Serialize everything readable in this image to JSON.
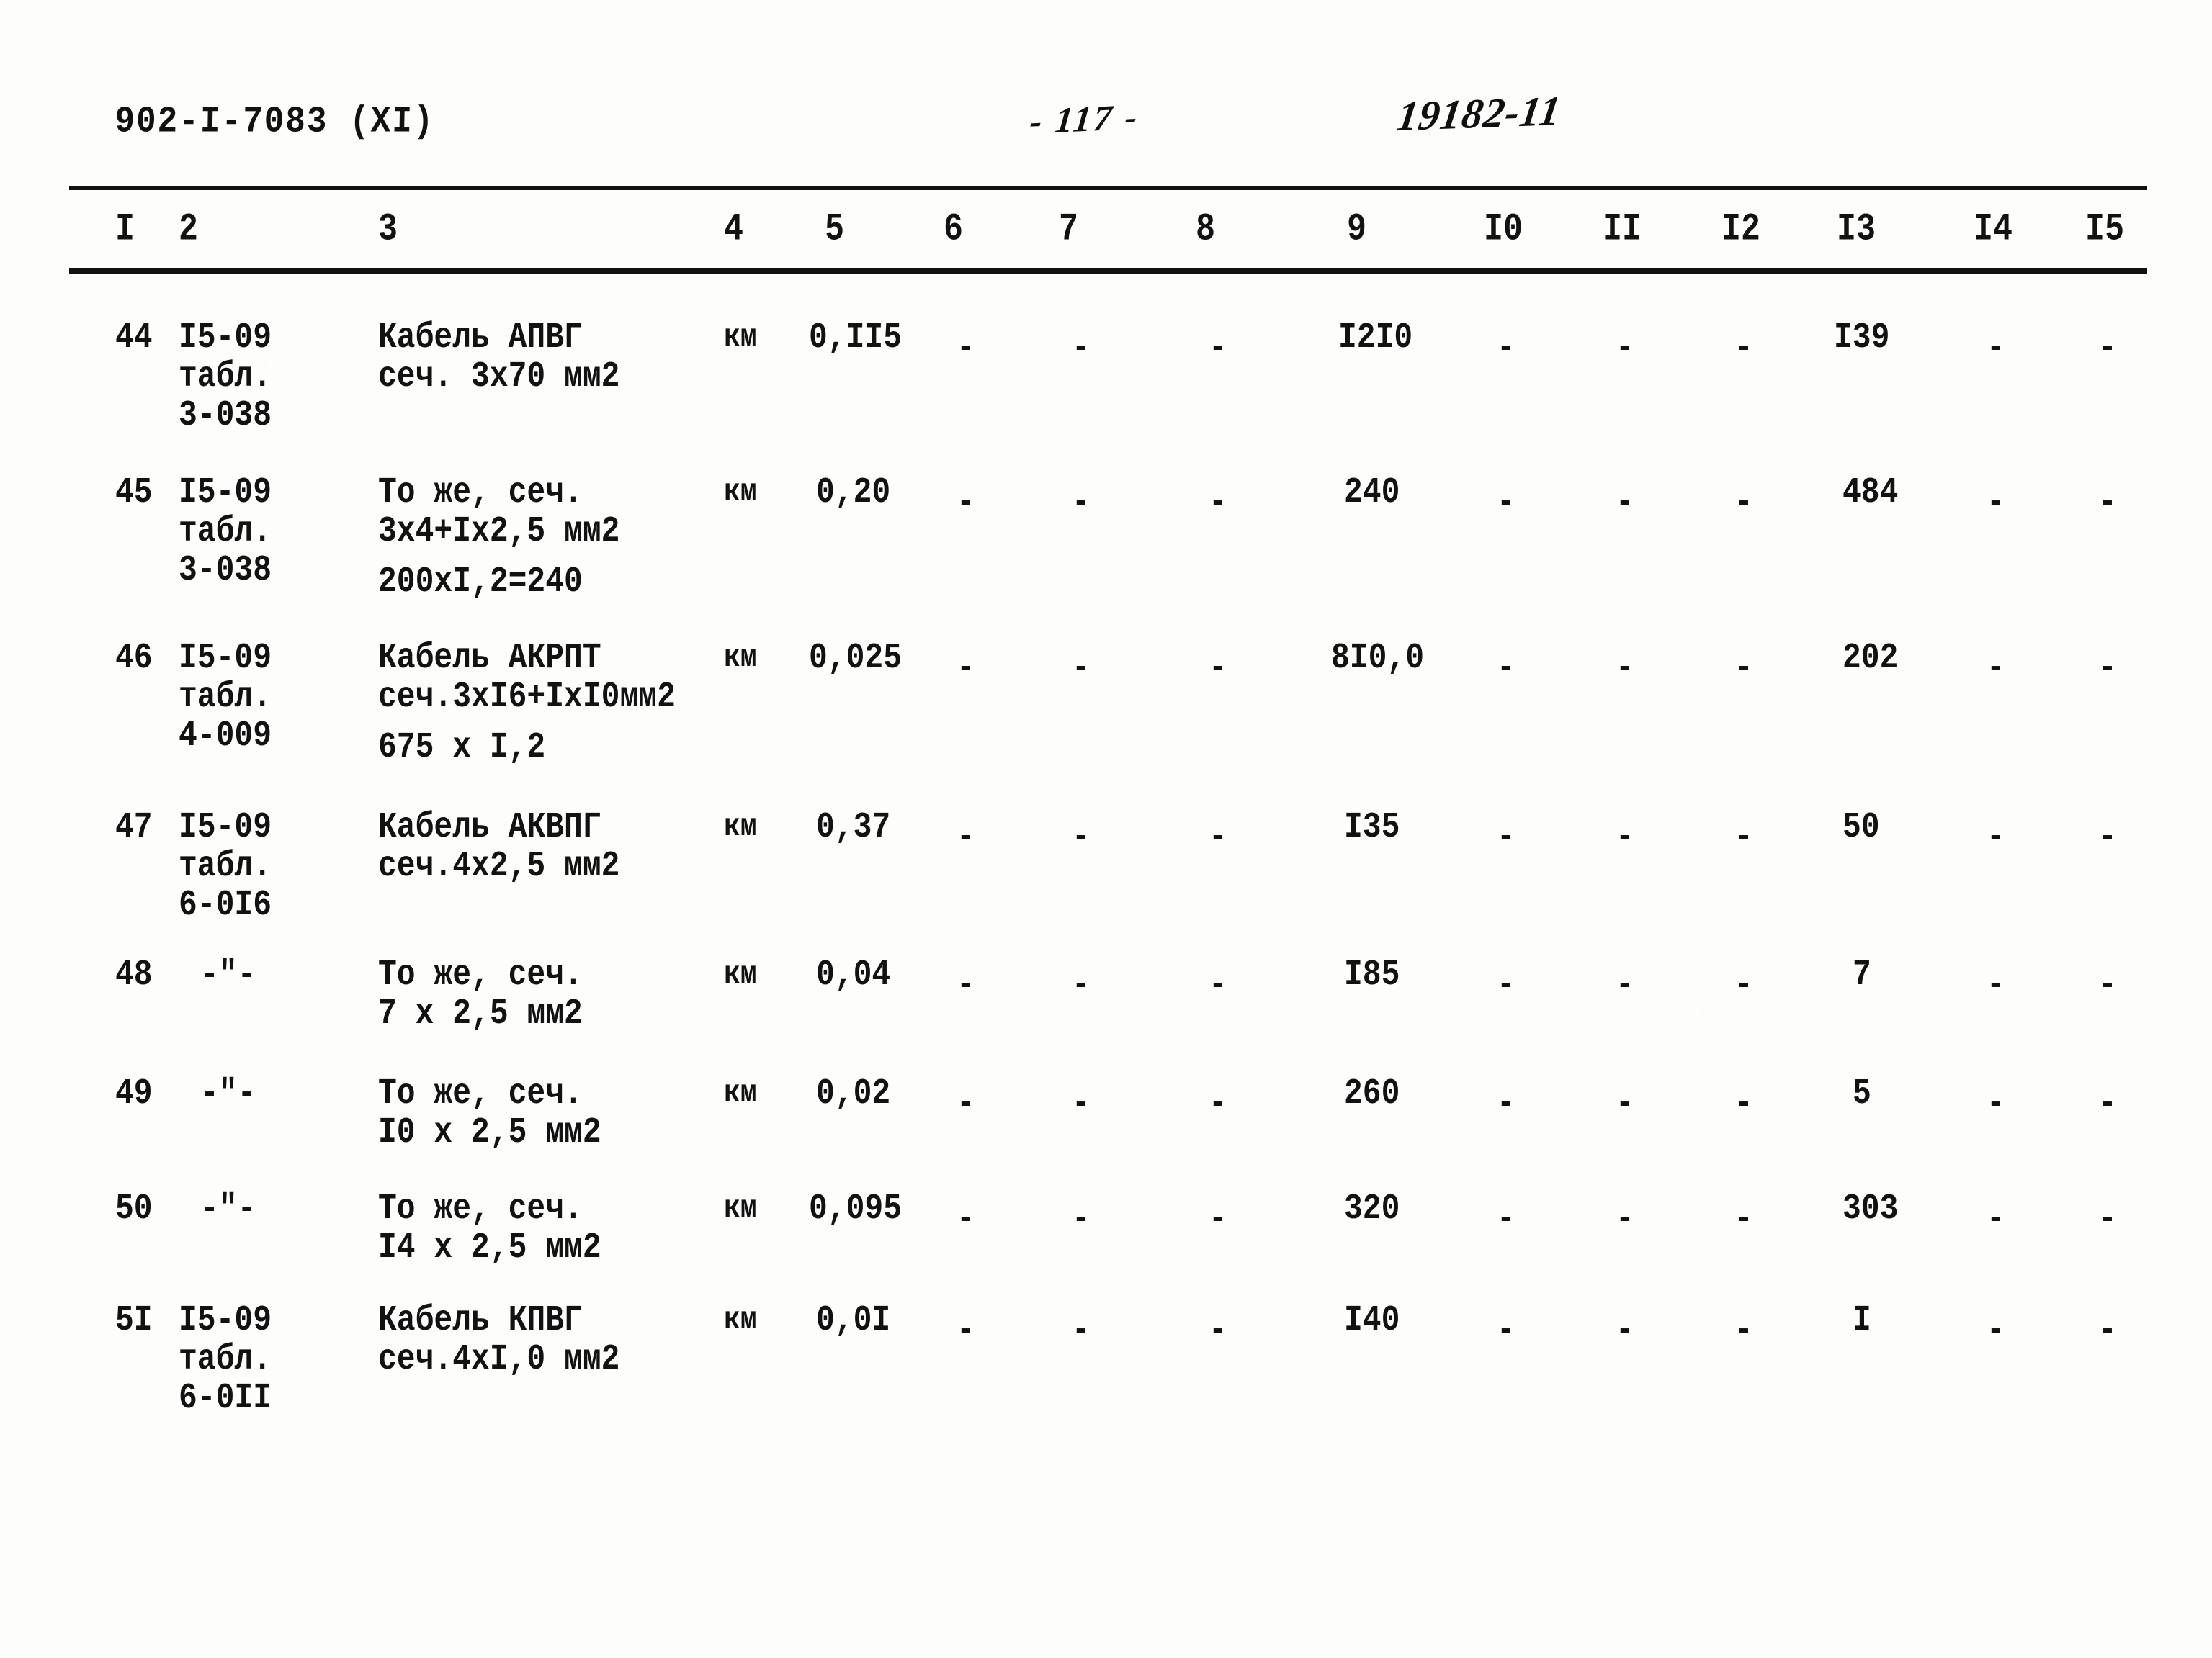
{
  "header": {
    "doc_code": "902-I-7083  (XI)",
    "page_number": "-  117  -",
    "hand_note": "19182-11"
  },
  "table": {
    "column_headers": [
      "I",
      "2",
      "3",
      "4",
      "5",
      "6",
      "7",
      "8",
      "9",
      "I0",
      "II",
      "I2",
      "I3",
      "I4",
      "I5"
    ],
    "dash_symbol": "-",
    "ditto_symbol": "-\"-",
    "rows": [
      {
        "num": "44",
        "ref_lines": [
          "I5-09",
          "табл.",
          "3-038"
        ],
        "name_lines": [
          "Кабель АПВГ",
          "сеч. 3х70 мм2"
        ],
        "unit": "км",
        "c5": "0,II5",
        "c6": "-",
        "c7": "-",
        "c8": "-",
        "c9": "I2I0",
        "c10": "-",
        "c11": "-",
        "c12": "-",
        "c13": "I39",
        "c13_over": "",
        "c14": "-",
        "c15": "-"
      },
      {
        "num": "45",
        "ref_lines": [
          "I5-09",
          "табл.",
          "3-038"
        ],
        "name_lines": [
          "То же, сеч.",
          "3х4+Iх2,5 мм2",
          "200хI,2=240"
        ],
        "unit": "км",
        "c5": "0,20",
        "c6": "-",
        "c7": "-",
        "c8": "-",
        "c9": "240",
        "c10": "-",
        "c11": "-",
        "c12": "-",
        "c13": "48",
        "c13_over": "4",
        "c14": "-",
        "c15": "-"
      },
      {
        "num": "46",
        "ref_lines": [
          "I5-09",
          "табл.",
          "4-009"
        ],
        "name_lines": [
          "Кабель АКРПТ",
          "сеч.3хI6+IхI0мм2",
          "675 х I,2"
        ],
        "unit": "км",
        "c5": "0,025",
        "c6": "-",
        "c7": "-",
        "c8": "-",
        "c9": "8I0,0",
        "c10": "-",
        "c11": "-",
        "c12": "-",
        "c13": "20",
        "c13_over": "2",
        "c14": "-",
        "c15": "-"
      },
      {
        "num": "47",
        "ref_lines": [
          "I5-09",
          "табл.",
          "6-0I6"
        ],
        "name_lines": [
          "Кабель АКВПГ",
          "сеч.4х2,5 мм2"
        ],
        "unit": "км",
        "c5": "0,37",
        "c6": "-",
        "c7": "-",
        "c8": "-",
        "c9": "I35",
        "c10": "-",
        "c11": "-",
        "c12": "-",
        "c13": "50",
        "c13_over": "",
        "c14": "-",
        "c15": "-"
      },
      {
        "num": "48",
        "ref_lines": [
          "-\"-"
        ],
        "name_lines": [
          "То же, сеч.",
          "7 х 2,5 мм2"
        ],
        "unit": "км",
        "c5": "0,04",
        "c6": "-",
        "c7": "-",
        "c8": "-",
        "c9": "I85",
        "c10": "-",
        "c11": "-",
        "c12": "-",
        "c13": "7",
        "c13_over": "",
        "c14": "-",
        "c15": "-"
      },
      {
        "num": "49",
        "ref_lines": [
          "-\"-"
        ],
        "name_lines": [
          "То же, сеч.",
          "I0 х 2,5 мм2"
        ],
        "unit": "км",
        "c5": "0,02",
        "c6": "-",
        "c7": "-",
        "c8": "-",
        "c9": "260",
        "c10": "-",
        "c11": "-",
        "c12": "-",
        "c13": "5",
        "c13_over": "",
        "c14": "-",
        "c15": "-"
      },
      {
        "num": "50",
        "ref_lines": [
          "-\"-"
        ],
        "name_lines": [
          "То же, сеч.",
          "I4 х 2,5 мм2"
        ],
        "unit": "км",
        "c5": "0,095",
        "c6": "-",
        "c7": "-",
        "c8": "-",
        "c9": "320",
        "c10": "-",
        "c11": "-",
        "c12": "-",
        "c13": "30",
        "c13_over": "3",
        "c14": "-",
        "c15": "-"
      },
      {
        "num": "5I",
        "ref_lines": [
          "I5-09",
          "табл.",
          "6-0II"
        ],
        "name_lines": [
          "Кабель КПВГ",
          "сеч.4хI,0 мм2"
        ],
        "unit": "км",
        "c5": "0,0I",
        "c6": "-",
        "c7": "-",
        "c8": "-",
        "c9": "I40",
        "c10": "-",
        "c11": "-",
        "c12": "-",
        "c13": "I",
        "c13_over": "",
        "c14": "-",
        "c15": "-"
      }
    ]
  },
  "layout": {
    "col_x": [
      160,
      248,
      525,
      1005,
      1145,
      1310,
      1470,
      1660,
      1870,
      2060,
      2225,
      2390,
      2550,
      2740,
      2895
    ],
    "row_y": [
      440,
      655,
      885,
      1120,
      1325,
      1490,
      1650,
      1805
    ],
    "line_h": 54
  }
}
